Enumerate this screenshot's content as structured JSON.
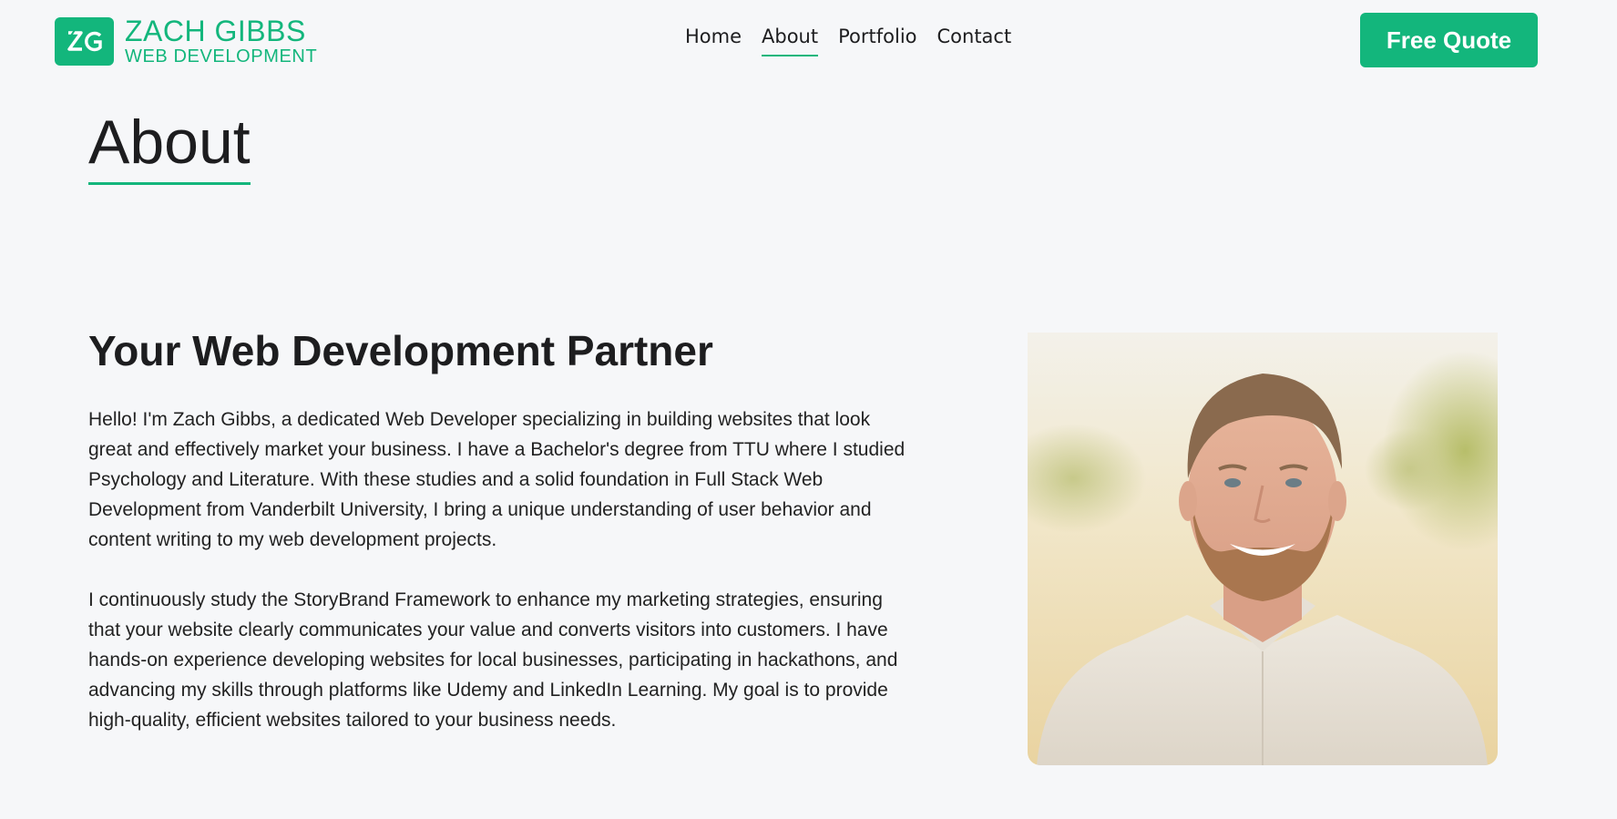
{
  "header": {
    "logo_mark": "ZG",
    "logo_name": "ZACH GIBBS",
    "logo_sub": "WEB DEVELOPMENT",
    "nav": [
      {
        "label": "Home",
        "active": false
      },
      {
        "label": "About",
        "active": true
      },
      {
        "label": "Portfolio",
        "active": false
      },
      {
        "label": "Contact",
        "active": false
      }
    ],
    "cta_label": "Free Quote"
  },
  "page": {
    "title": "About"
  },
  "content": {
    "heading": "Your Web Development Partner",
    "paragraphs": [
      "Hello! I'm Zach Gibbs, a dedicated Web Developer specializing in building websites that look great and effectively market your business. I have a Bachelor's degree from TTU where I studied Psychology and Literature. With these studies and a solid foundation in Full Stack Web Development from Vanderbilt University, I bring a unique understanding of user behavior and content writing to my web development projects.",
      "I continuously study the StoryBrand Framework to enhance my marketing strategies, ensuring that your website clearly communicates your value and converts visitors into customers. I have hands-on experience developing websites for local businesses, participating in hackathons, and advancing my skills through platforms like Udemy and LinkedIn Learning. My goal is to provide high-quality, efficient websites tailored to your business needs."
    ]
  },
  "colors": {
    "accent": "#13b67c",
    "background": "#f6f7f9",
    "text": "#1d1d1f"
  },
  "icons": {
    "logo": "zg-monogram-icon"
  }
}
